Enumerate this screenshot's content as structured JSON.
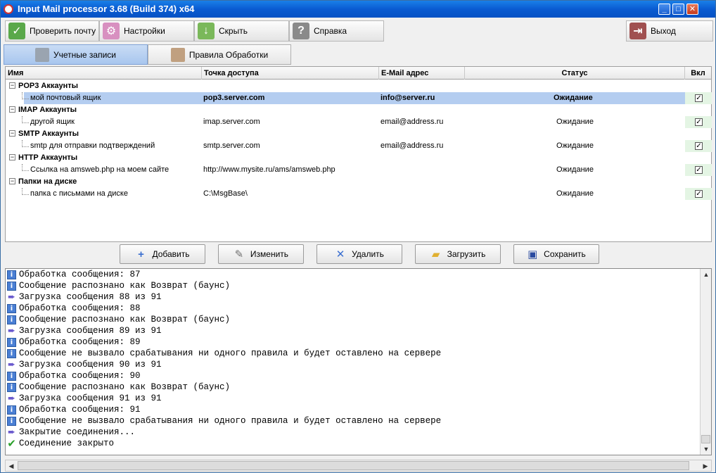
{
  "window": {
    "title": "Input Mail processor 3.68 (Build 374) x64",
    "minimize": "_",
    "maximize": "□",
    "close": "✕"
  },
  "toolbar": {
    "check_mail": "Проверить почту",
    "settings": "Настройки",
    "hide": "Скрыть",
    "help": "Справка",
    "exit": "Выход"
  },
  "tabs": {
    "accounts": "Учетные записи",
    "rules": "Правила Обработки"
  },
  "grid": {
    "columns": {
      "name": "Имя",
      "access_point": "Точка доступа",
      "email": "E-Mail адрес",
      "status": "Статус",
      "enabled": "Вкл"
    },
    "groups": [
      {
        "label": "POP3 Аккаунты",
        "item": {
          "name": "мой почтовый ящик",
          "access_point": "pop3.server.com",
          "email": "info@server.ru",
          "status": "Ожидание",
          "enabled": true
        }
      },
      {
        "label": "IMAP Аккаунты",
        "item": {
          "name": "другой ящик",
          "access_point": "imap.server.com",
          "email": "email@address.ru",
          "status": "Ожидание",
          "enabled": true
        }
      },
      {
        "label": "SMTP Аккаунты",
        "item": {
          "name": "smtp для отправки подтверждений",
          "access_point": "smtp.server.com",
          "email": "email@address.ru",
          "status": "Ожидание",
          "enabled": true
        }
      },
      {
        "label": "HTTP Аккаунты",
        "item": {
          "name": "Ссылка на amsweb.php на моем сайте",
          "access_point": "http://www.mysite.ru/ams/amsweb.php",
          "email": "",
          "status": "Ожидание",
          "enabled": true
        }
      },
      {
        "label": "Папки на диске",
        "item": {
          "name": "папка с письмами на диске",
          "access_point": "C:\\MsgBase\\",
          "email": "",
          "status": "Ожидание",
          "enabled": true
        }
      }
    ],
    "checkmark": "✓"
  },
  "actions": {
    "add": "Добавить",
    "edit": "Изменить",
    "delete": "Удалить",
    "load": "Загрузить",
    "save": "Сохранить"
  },
  "log": [
    {
      "icon": "info",
      "text": "Обработка сообщения: 87"
    },
    {
      "icon": "info",
      "text": "Сообщение распознано как Возврат (баунс)"
    },
    {
      "icon": "arrow",
      "text": "Загрузка сообщения 88 из 91"
    },
    {
      "icon": "info",
      "text": "Обработка сообщения: 88"
    },
    {
      "icon": "info",
      "text": "Сообщение распознано как Возврат (баунс)"
    },
    {
      "icon": "arrow",
      "text": "Загрузка сообщения 89 из 91"
    },
    {
      "icon": "info",
      "text": "Обработка сообщения: 89"
    },
    {
      "icon": "info",
      "text": "Сообщение не вызвало срабатывания ни одного правила и будет оставлено на сервере"
    },
    {
      "icon": "arrow",
      "text": "Загрузка сообщения 90 из 91"
    },
    {
      "icon": "info",
      "text": "Обработка сообщения: 90"
    },
    {
      "icon": "info",
      "text": "Сообщение распознано как Возврат (баунс)"
    },
    {
      "icon": "arrow",
      "text": "Загрузка сообщения 91 из 91"
    },
    {
      "icon": "info",
      "text": "Обработка сообщения: 91"
    },
    {
      "icon": "info",
      "text": "Сообщение не вызвало срабатывания ни одного правила и будет оставлено на сервере"
    },
    {
      "icon": "arrow",
      "text": "Закрытие соединения..."
    },
    {
      "icon": "ok",
      "text": "Соединение закрыто"
    }
  ],
  "colors": {
    "selection": "#b4cdf0",
    "enabled_cell": "#e4f5e4",
    "titlebar": "#0a5bd1"
  }
}
